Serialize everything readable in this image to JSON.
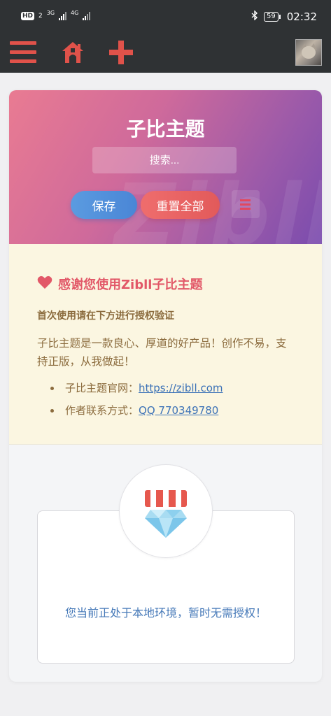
{
  "status_bar": {
    "network_badge": "HD",
    "sim_label": "2",
    "signal1_label": "3G",
    "signal2_label": "4G",
    "battery": "59",
    "time": "02:32"
  },
  "nav": {
    "menu_icon": "hamburger-menu-icon",
    "home_icon": "home-icon",
    "add_icon": "plus-icon",
    "accent_color": "#e0524a"
  },
  "hero": {
    "title": "子比主题",
    "search_placeholder": "搜索...",
    "save_label": "保存",
    "reset_label": "重置全部",
    "watermark": "Zibll"
  },
  "notice": {
    "heading": "感谢您使用Zibll子比主题",
    "subheading": "首次使用请在下方进行授权验证",
    "body": "子比主题是一款良心、厚道的好产品！创作不易，支持正版，从我做起！",
    "items": [
      {
        "label": "子比主题官网：",
        "link": "https://zibll.com"
      },
      {
        "label": "作者联系方式：",
        "link": "QQ 770349780"
      }
    ]
  },
  "license": {
    "message": "您当前正处于本地环境，暂时无需授权！",
    "icon": "diamond-store-icon"
  }
}
